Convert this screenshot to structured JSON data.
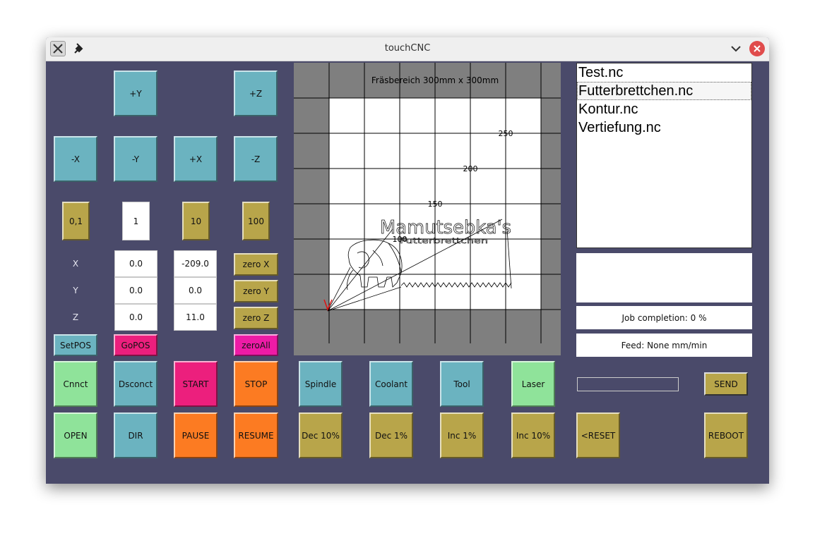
{
  "window": {
    "title": "touchCNC"
  },
  "icons": {
    "app": "app-icon",
    "pin": "pin-icon",
    "minimize": "chevron-down-icon",
    "close": "close-icon"
  },
  "jog": {
    "plus_y": "+Y",
    "plus_z": "+Z",
    "minus_x": "-X",
    "minus_y": "-Y",
    "plus_x": "+X",
    "minus_z": "-Z"
  },
  "steps": {
    "s01": "0,1",
    "s1": "1",
    "s10": "10",
    "s100": "100"
  },
  "axes": {
    "x_label": "X",
    "y_label": "Y",
    "z_label": "Z"
  },
  "positions": {
    "x_set": "0.0",
    "y_set": "0.0",
    "z_set": "0.0",
    "x_cur": "-209.0",
    "y_cur": "0.0",
    "z_cur": "11.0"
  },
  "zero": {
    "x": "zero X",
    "y": "zero Y",
    "z": "zero Z",
    "all": "zeroAll"
  },
  "pos_buttons": {
    "setpos": "SetPOS",
    "gopos": "GoPOS"
  },
  "canvas": {
    "title": "Fräsbereich 300mm x 300mm",
    "labels": [
      "250",
      "200",
      "150",
      "100"
    ],
    "drawing_title": "Mamutsebka's",
    "drawing_subtitle": "Futterbrettchen"
  },
  "files": [
    {
      "name": "Test.nc",
      "selected": false
    },
    {
      "name": "Futterbrettchen.nc",
      "selected": true
    },
    {
      "name": "Kontur.nc",
      "selected": false
    },
    {
      "name": "Vertiefung.nc",
      "selected": false
    }
  ],
  "status": {
    "job": "Job completion: 0 %",
    "feed": "Feed: None mm/min"
  },
  "send": {
    "input_value": "",
    "label": "SEND"
  },
  "row1": {
    "connect": "Cnnct",
    "disconnect": "Dsconct",
    "start": "START",
    "stop": "STOP",
    "spindle": "Spindle",
    "coolant": "Coolant",
    "tool": "Tool",
    "laser": "Laser"
  },
  "row2": {
    "open": "OPEN",
    "dir": "DIR",
    "pause": "PAUSE",
    "resume": "RESUME",
    "dec10": "Dec 10%",
    "dec1": "Dec 1%",
    "inc1": "Inc 1%",
    "inc10": "Inc 10%",
    "reset": "<RESET",
    "reboot": "REBOOT"
  },
  "colors": {
    "bg": "#4a4a6a",
    "teal": "#6bb3c0",
    "gold": "#b8a54a",
    "green": "#8fe39a",
    "pink": "#ec1f7d",
    "orange": "#fc7b22",
    "magenta": "#ee1ba6",
    "tool_marker": "#e01010"
  }
}
